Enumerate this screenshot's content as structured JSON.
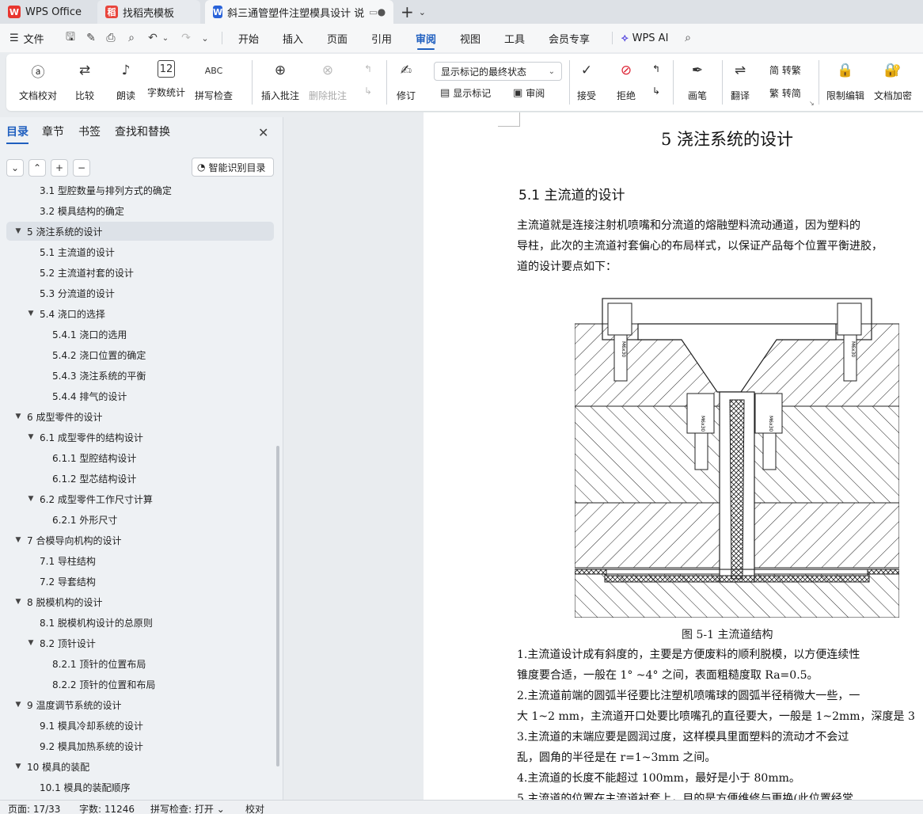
{
  "tabs": {
    "wps": "WPS Office",
    "template": "找稻壳模板",
    "doc": "斜三通管塑件注塑模具设计 说"
  },
  "menu": {
    "file": "文件",
    "items": [
      "开始",
      "插入",
      "页面",
      "引用",
      "审阅",
      "视图",
      "工具",
      "会员专享"
    ],
    "active": "审阅",
    "wps_ai": "WPS AI"
  },
  "ribbon": {
    "doc_proofread": "文档校对",
    "compare": "比较",
    "read_aloud": "朗读",
    "word_count": "字数统计",
    "spell_check": "拼写检查",
    "insert_comment": "插入批注",
    "delete_comment": "删除批注",
    "revise": "修订",
    "markup_select": "显示标记的最终状态",
    "show_markup": "显示标记",
    "review": "审阅",
    "accept": "接受",
    "reject": "拒绝",
    "pen": "画笔",
    "translate": "翻译",
    "to_traditional": "简 转繁",
    "to_simplified": "繁 转简",
    "restrict_edit": "限制编辑",
    "doc_encrypt": "文档加密"
  },
  "nav": {
    "tabs": [
      "目录",
      "章节",
      "书签",
      "查找和替换"
    ],
    "smart_btn": "智能识别目录",
    "toc": [
      {
        "text": "3.1 型腔数量与排列方式的确定",
        "level": 2
      },
      {
        "text": "3.2  模具结构的确定",
        "level": 2
      },
      {
        "text": "5   浇注系统的设计",
        "level": 1,
        "expanded": true,
        "selected": true
      },
      {
        "text": "5.1  主流道的设计",
        "level": 2
      },
      {
        "text": "5.2  主流道衬套的设计",
        "level": 2
      },
      {
        "text": "5.3  分流道的设计",
        "level": 2
      },
      {
        "text": "5.4  浇口的选择",
        "level": 2,
        "expanded": true
      },
      {
        "text": "5.4.1  浇口的选用",
        "level": 3
      },
      {
        "text": "5.4.2  浇口位置的确定",
        "level": 3
      },
      {
        "text": "5.4.3  浇注系统的平衡",
        "level": 3
      },
      {
        "text": "5.4.4  排气的设计",
        "level": 3
      },
      {
        "text": "6  成型零件的设计",
        "level": 1,
        "expanded": true
      },
      {
        "text": "6.1  成型零件的结构设计",
        "level": 2,
        "expanded": true
      },
      {
        "text": "6.1.1  型腔结构设计",
        "level": 3
      },
      {
        "text": "6.1.2  型芯结构设计",
        "level": 3
      },
      {
        "text": "6.2  成型零件工作尺寸计算",
        "level": 2,
        "expanded": true
      },
      {
        "text": "6.2.1  外形尺寸",
        "level": 3
      },
      {
        "text": "7   合模导向机构的设计",
        "level": 1,
        "expanded": true
      },
      {
        "text": "7.1  导柱结构",
        "level": 2
      },
      {
        "text": "7.2  导套结构",
        "level": 2
      },
      {
        "text": "8 脱模机构的设计",
        "level": 1,
        "expanded": true
      },
      {
        "text": "8.1  脱模机构设计的总原则",
        "level": 2
      },
      {
        "text": "8.2  顶针设计",
        "level": 2,
        "expanded": true
      },
      {
        "text": "8.2.1  顶针的位置布局",
        "level": 3
      },
      {
        "text": "8.2.2  顶针的位置和布局",
        "level": 3
      },
      {
        "text": "9  温度调节系统的设计",
        "level": 1,
        "expanded": true
      },
      {
        "text": "9.1  模具冷却系统的设计",
        "level": 2
      },
      {
        "text": "9.2  模具加热系统的设计",
        "level": 2
      },
      {
        "text": "10  模具的装配",
        "level": 1,
        "expanded": true
      },
      {
        "text": "10.1  模具的装配顺序",
        "level": 2
      }
    ]
  },
  "doc": {
    "h1": "5   浇注系统的设计",
    "h2": "5.1 主流道的设计",
    "lines": [
      "    主流道就是连接注射机喷嘴和分流道的熔融塑料流动通道，因为塑料的",
      "导柱，此次的主流道衬套偏心的布局样式，以保证产品每个位置平衡进胶，",
      "道的设计要点如下："
    ],
    "caption": "图 5-1  主流道结构",
    "lines2": [
      "    1.主流道设计成有斜度的，主要是方便废料的顺利脱模，以方便连续性",
      "锥度要合适，一般在 1° ~4° 之间，表面粗糙度取 Ra=0.5。",
      "    2.主流道前端的圆弧半径要比注塑机喷嘴球的圆弧半径稍微大一些，一",
      "大 1~2 mm，主流道开口处要比喷嘴孔的直径要大，一般是 1~2mm，深度是 3",
      "    3.主流道的末端应要是圆润过度，这样模具里面塑料的流动才不会过",
      "乱，圆角的半径是在 r=1~3mm 之间。",
      "    4.主流道的长度不能超过 100mm，最好是小于 80mm。",
      "    5.主流道的位置在主流道衬套上，目的是方便维修与更换(此位置经常"
    ],
    "bolt_label": "M6x30"
  },
  "status": {
    "page": "页面: 17/33",
    "words": "字数: 11246",
    "spell": "拼写检查: 打开",
    "proof": "校对"
  },
  "colors": {
    "accent": "#1f5fbf",
    "wps_red": "#e8362f",
    "template_red": "#e8453c",
    "doc_blue": "#2a63d9"
  }
}
